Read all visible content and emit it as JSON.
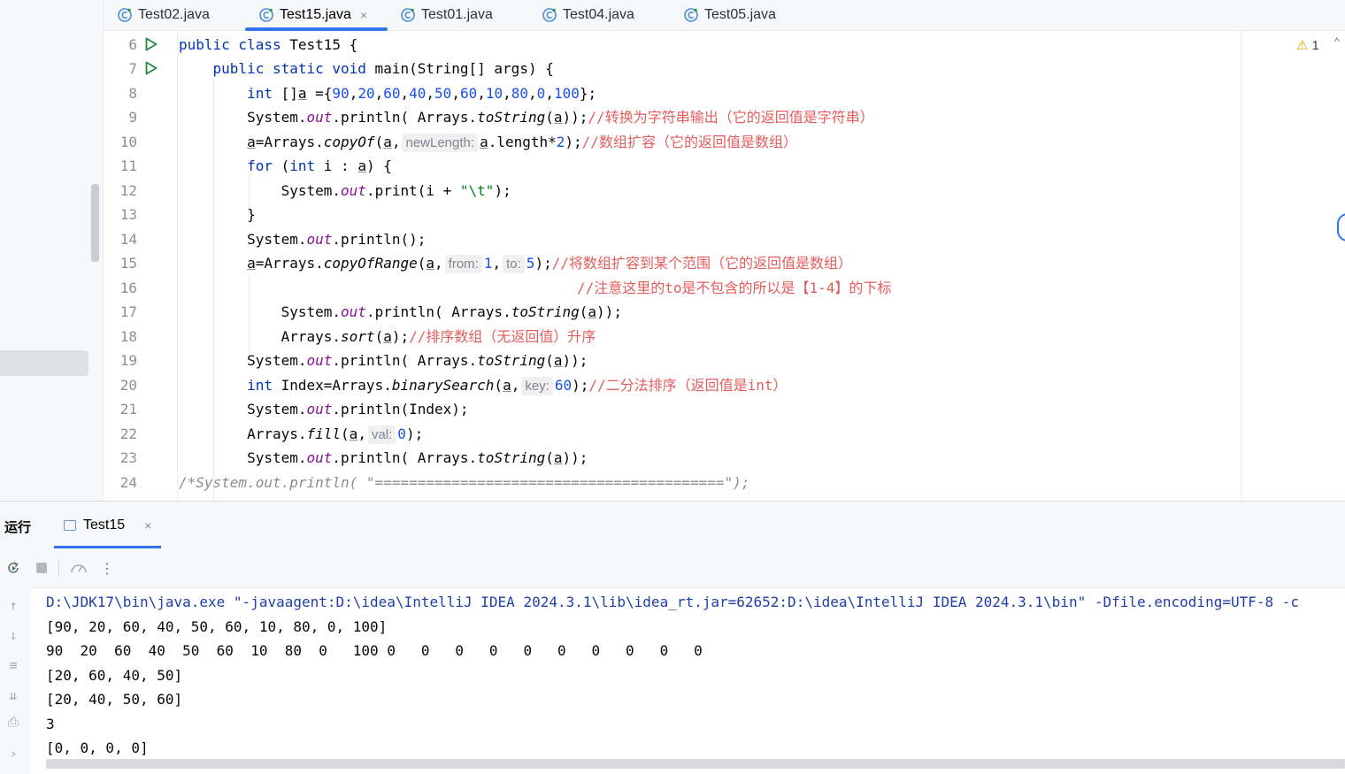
{
  "tabs": [
    {
      "label": "Test02.java",
      "active": false
    },
    {
      "label": "Test15.java",
      "active": true,
      "close": "×"
    },
    {
      "label": "Test01.java",
      "active": false
    },
    {
      "label": "Test04.java",
      "active": false
    },
    {
      "label": "Test05.java",
      "active": false
    }
  ],
  "editor": {
    "line_numbers": [
      "6",
      "7",
      "8",
      "9",
      "10",
      "11",
      "12",
      "13",
      "14",
      "15",
      "16",
      "17",
      "18",
      "19",
      "20",
      "21",
      "22",
      "23",
      "24"
    ],
    "warning_count": "1",
    "hints": {
      "newLength": "newLength:",
      "from": "from:",
      "to": "to:",
      "key": "key:",
      "val": "val:"
    },
    "comments": {
      "l9": "//转换为字符串输出（它的返回值是字符串）",
      "l10": "//数组扩容（它的返回值是数组）",
      "l15": "//将数组扩容到某个范围（它的返回值是数组）",
      "l16": "//注意这里的to是不包含的所以是【1-4】的下标",
      "l18": "//排序数组（无返回值）升序",
      "l20": "//二分法排序（返回值是int）"
    }
  },
  "run_panel": {
    "title": "运行",
    "tab_label": "Test15",
    "tab_close": "×",
    "console_lines": [
      "D:\\JDK17\\bin\\java.exe \"-javaagent:D:\\idea\\IntelliJ IDEA 2024.3.1\\lib\\idea_rt.jar=62652:D:\\idea\\IntelliJ IDEA 2024.3.1\\bin\" -Dfile.encoding=UTF-8 -c",
      "[90, 20, 60, 40, 50, 60, 10, 80, 0, 100]",
      "90  20  60  40  50  60  10  80  0   100 0   0   0   0   0   0   0   0   0   0",
      "[20, 60, 40, 50]",
      "[20, 40, 50, 60]",
      "3",
      "[0, 0, 0, 0]"
    ]
  },
  "icons": {
    "java_file": "java-class-file-icon",
    "run_gutter": "run-triangle-icon",
    "rerun": "rerun-icon",
    "stop": "stop-icon",
    "coverage": "coverage-gauge-icon",
    "more": "more-vertical-icon",
    "up": "arrow-up-icon",
    "down": "arrow-down-icon",
    "softwrap": "soft-wrap-icon",
    "scroll_end": "scroll-to-end-icon",
    "print": "print-icon",
    "expand": "chevron-right-icon"
  },
  "colors": {
    "accent": "#3574f0",
    "keyword": "#0033b3",
    "number": "#1750eb",
    "string": "#067d17",
    "field": "#871094",
    "comment_cn": "#e45d5d",
    "run_green": "#208a3c"
  }
}
